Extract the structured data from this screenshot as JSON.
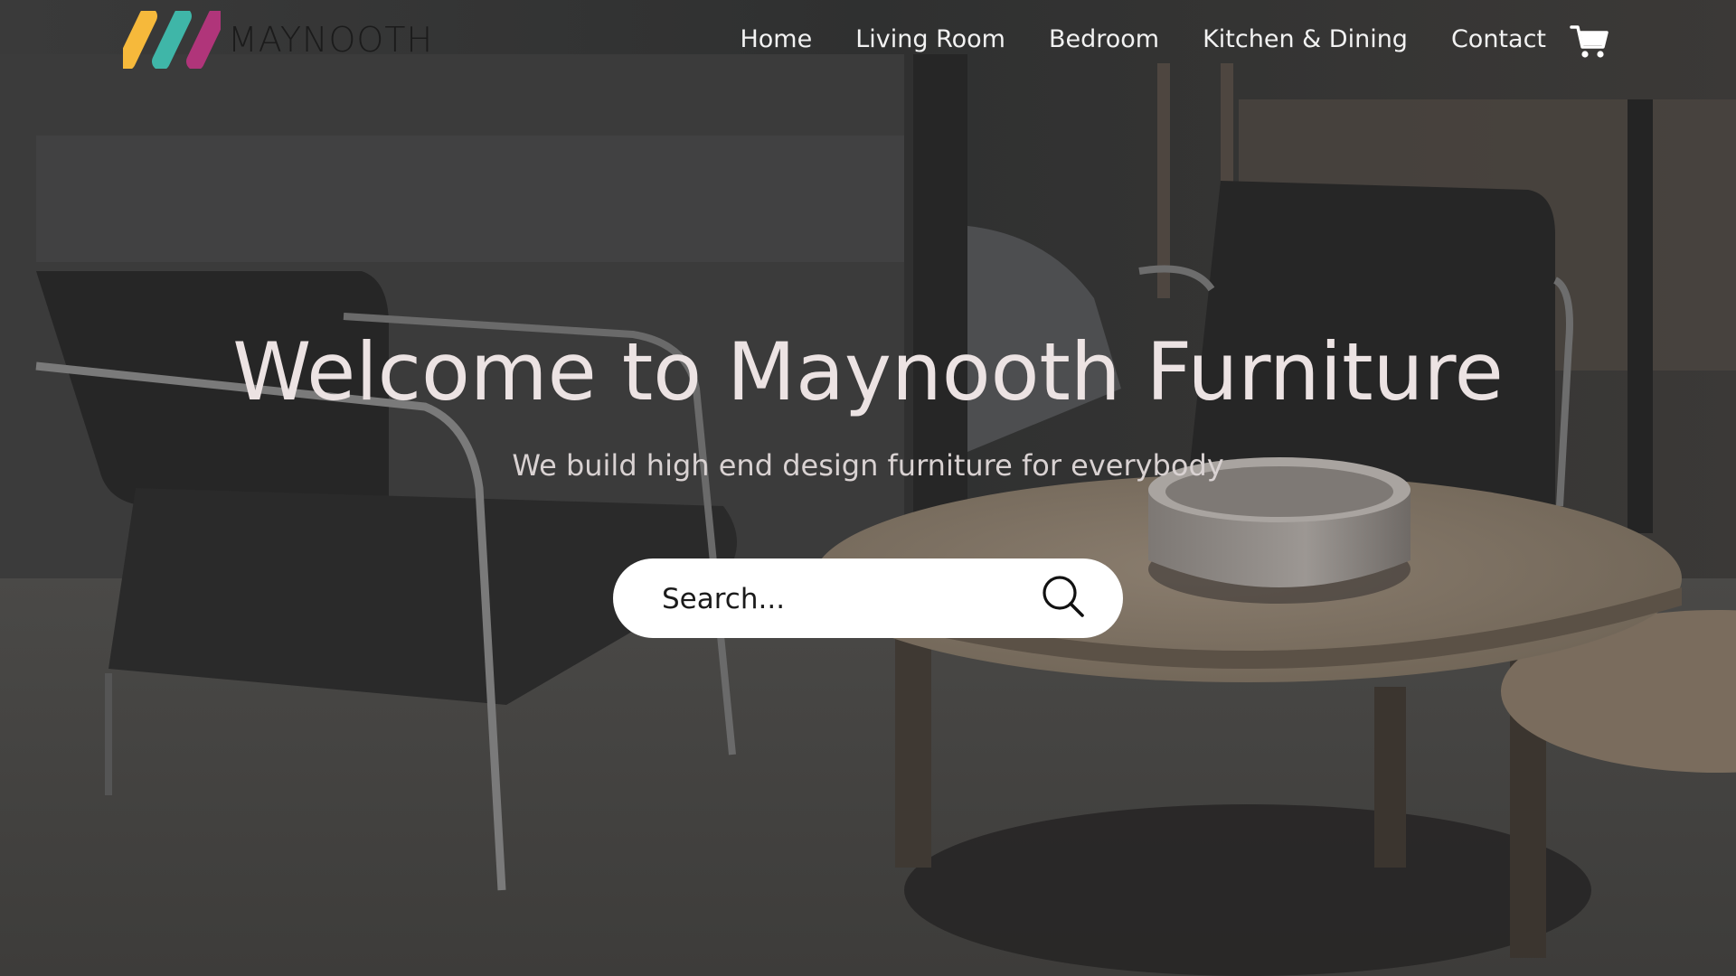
{
  "brand": {
    "name": "MAYNOOTH",
    "logo_colors": [
      "#f6b93b",
      "#3fb6a8",
      "#b0357a"
    ]
  },
  "nav": {
    "items": [
      {
        "label": "Home"
      },
      {
        "label": "Living Room"
      },
      {
        "label": "Bedroom"
      },
      {
        "label": "Kitchen & Dining"
      },
      {
        "label": "Contact"
      }
    ],
    "cart_icon": "cart-icon"
  },
  "hero": {
    "title": "Welcome to Maynooth Furniture",
    "subtitle": "We build high end design furniture for everybody"
  },
  "search": {
    "placeholder": "Search...",
    "icon": "search-icon"
  },
  "colors": {
    "title_text": "#ece3e3",
    "nav_text": "#f2f2f2",
    "overlay": "#35363a"
  }
}
